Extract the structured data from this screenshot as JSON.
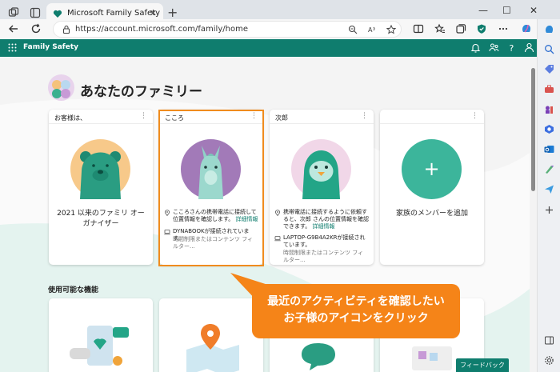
{
  "browser": {
    "tab_title": "Microsoft Family Safety",
    "tab_close": "✕",
    "new_tab": "+",
    "url": "https://account.microsoft.com/family/home",
    "win_min": "—",
    "win_max": "☐",
    "win_close": "✕"
  },
  "app": {
    "name": "Family Safety"
  },
  "page": {
    "title": "あなたのファミリー",
    "more": "⋮",
    "cards": [
      {
        "header": "お客様は、",
        "name": "2021 以来のファミリ オーガナイザー"
      },
      {
        "header": "こころ",
        "location": "こころさんの携帯電話に接続して位置情報を確認します。",
        "location_link": "詳細情報",
        "device": "DYNABOOKが接続されています。",
        "device_sub": "時間制限またはコンテンツ フィルター..."
      },
      {
        "header": "次郎",
        "location": "携帯電話に接続するように依頼すると、次郎 さんの位置情報を確認できます。",
        "location_link": "詳細情報",
        "device": "LAPTOP-G9B4A2KRが接続されています。",
        "device_sub": "時間制限またはコンテンツ フィルター..."
      },
      {
        "header": "",
        "plus": "+",
        "name": "家族のメンバーを追加"
      }
    ],
    "features_title": "使用可能な機能",
    "feedback": "フィードバック"
  },
  "callout": {
    "line1": "最近のアクティビティを確認したい",
    "line2": "お子様のアイコンをクリック"
  },
  "colors": {
    "brand": "#0f7d6e",
    "highlight": "#f08c1e",
    "callout": "#f58418"
  }
}
